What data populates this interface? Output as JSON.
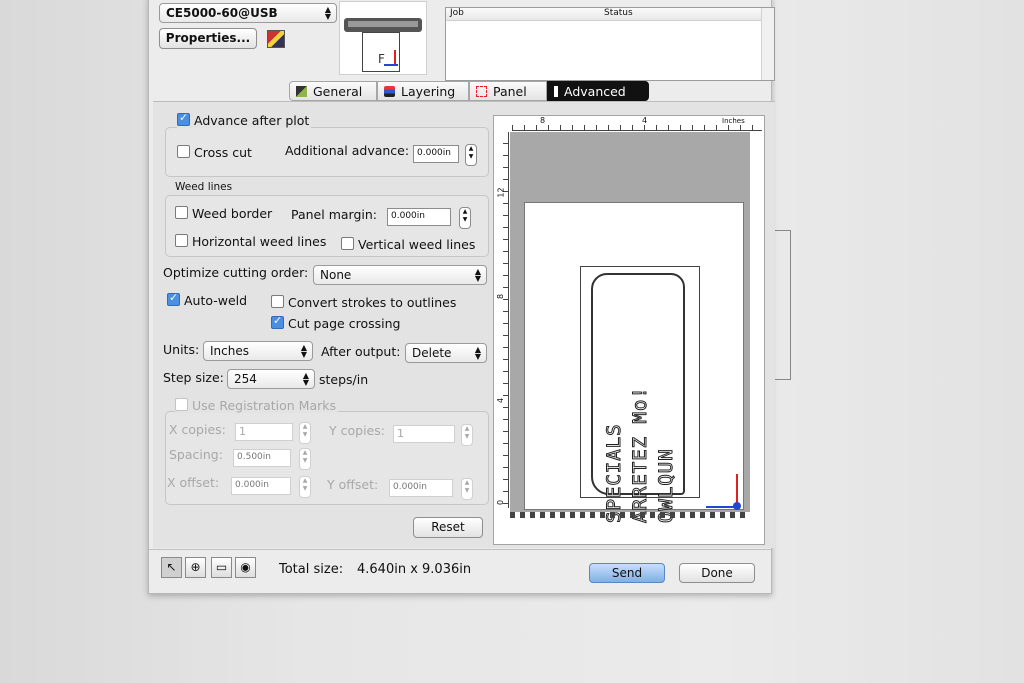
{
  "device": {
    "selected": "CE5000-60@USB",
    "properties_label": "Properties..."
  },
  "jobs": {
    "col_job": "Job",
    "col_status": "Status"
  },
  "tabs": [
    {
      "label": "General",
      "icon": "general-icon"
    },
    {
      "label": "Layering",
      "icon": "layering-icon"
    },
    {
      "label": "Panel",
      "icon": "panel-icon"
    },
    {
      "label": "Advanced",
      "icon": "advanced-icon",
      "selected": true
    }
  ],
  "advanced": {
    "advance_after_plot": {
      "label": "Advance after plot",
      "checked": true
    },
    "cross_cut": {
      "label": "Cross cut",
      "checked": false
    },
    "additional_advance": {
      "label": "Additional advance:",
      "value": "0.000in"
    },
    "weed_lines": {
      "title": "Weed lines",
      "weed_border": {
        "label": "Weed border",
        "checked": false
      },
      "panel_margin": {
        "label": "Panel margin:",
        "value": "0.000in"
      },
      "horizontal": {
        "label": "Horizontal weed lines",
        "checked": false
      },
      "vertical": {
        "label": "Vertical weed lines",
        "checked": false
      }
    },
    "optimize": {
      "label": "Optimize cutting order:",
      "value": "None"
    },
    "auto_weld": {
      "label": "Auto-weld",
      "checked": true
    },
    "convert_strokes": {
      "label": "Convert strokes to outlines",
      "checked": false
    },
    "cut_page_crossing": {
      "label": "Cut page crossing",
      "checked": true
    },
    "units": {
      "label": "Units:",
      "value": "Inches"
    },
    "after_output": {
      "label": "After output:",
      "value": "Delete"
    },
    "step_size": {
      "label": "Step size:",
      "value": "254",
      "unit": "steps/in"
    },
    "registration": {
      "label": "Use Registration Marks",
      "checked": false,
      "x_copies": {
        "label": "X copies:",
        "value": "1"
      },
      "y_copies": {
        "label": "Y copies:",
        "value": "1"
      },
      "spacing": {
        "label": "Spacing:",
        "value": "0.500in"
      },
      "x_offset": {
        "label": "X offset:",
        "value": "0.000in"
      },
      "y_offset": {
        "label": "Y offset:",
        "value": "0.000in"
      }
    },
    "reset_label": "Reset"
  },
  "preview": {
    "ruler_top": [
      "8",
      "4",
      "Inches"
    ],
    "ruler_left": [
      "12",
      "8",
      "4",
      "0"
    ],
    "artwork_lines": [
      "SPECIALS",
      "ARRETEZ Mo!",
      "OWLQUN"
    ]
  },
  "footer": {
    "total_size_label": "Total size:",
    "total_size_value": "4.640in x 9.036in",
    "send_label": "Send",
    "done_label": "Done"
  },
  "colors": {
    "accent": "#4a8fe0",
    "tab_selected": "#111111",
    "send": "#9fc4ee"
  }
}
